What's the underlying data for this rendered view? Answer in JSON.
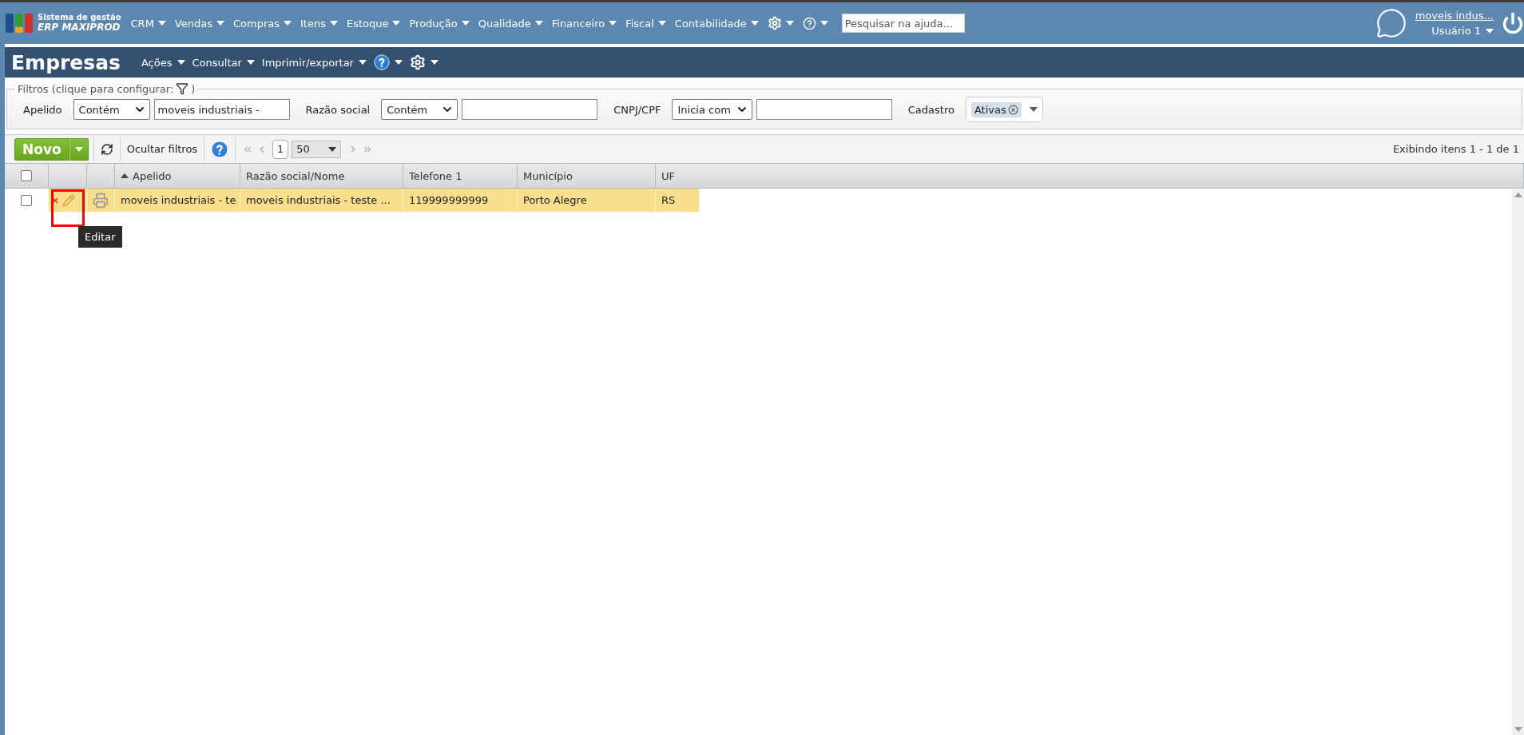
{
  "brand": {
    "line1": "Sistema de gestão",
    "line2": "ERP MAXIPROD"
  },
  "nav": [
    {
      "label": "CRM"
    },
    {
      "label": "Vendas"
    },
    {
      "label": "Compras"
    },
    {
      "label": "Itens"
    },
    {
      "label": "Estoque"
    },
    {
      "label": "Produção"
    },
    {
      "label": "Qualidade"
    },
    {
      "label": "Financeiro"
    },
    {
      "label": "Fiscal"
    },
    {
      "label": "Contabilidade"
    }
  ],
  "help_search": {
    "placeholder": "Pesquisar na ajuda..."
  },
  "user": {
    "company": "moveis indus...",
    "name": "Usuário 1"
  },
  "page": {
    "title": "Empresas",
    "menus": [
      {
        "label": "Ações"
      },
      {
        "label": "Consultar"
      },
      {
        "label": "Imprimir/exportar"
      }
    ]
  },
  "filters": {
    "legend": "Filtros (clique para configurar:",
    "legend_end": ")",
    "fields": [
      {
        "kind": "text",
        "label": "Apelido",
        "operator": "Contém",
        "value": "moveis industriais -"
      },
      {
        "kind": "text",
        "label": "Razão social",
        "operator": "Contém"
      },
      {
        "kind": "text",
        "label": "CNPJ/CPF",
        "operator": "Inicia com"
      },
      {
        "kind": "tags",
        "label": "Cadastro",
        "tags": [
          "Ativas"
        ]
      }
    ]
  },
  "toolbar": {
    "new_button": "Novo",
    "hide_filters": "Ocultar filtros",
    "page": "1",
    "page_size": "50",
    "summary": "Exibindo itens 1 - 1 de 1"
  },
  "table": {
    "all_checked": false,
    "columns": [
      {
        "label": "Apelido",
        "sorted": true
      },
      {
        "label": "Razão social/Nome",
        "sorted": false
      },
      {
        "label": "Telefone 1",
        "sorted": false
      },
      {
        "label": "Município",
        "sorted": false
      },
      {
        "label": "UF",
        "sorted": false
      }
    ],
    "rows": [
      {
        "checked": false,
        "hovered": true,
        "cells": [
          "moveis industriais - te",
          "moveis industriais - teste ...",
          "119999999999",
          "Porto Alegre",
          "RS"
        ]
      }
    ]
  },
  "tooltip": "Editar"
}
